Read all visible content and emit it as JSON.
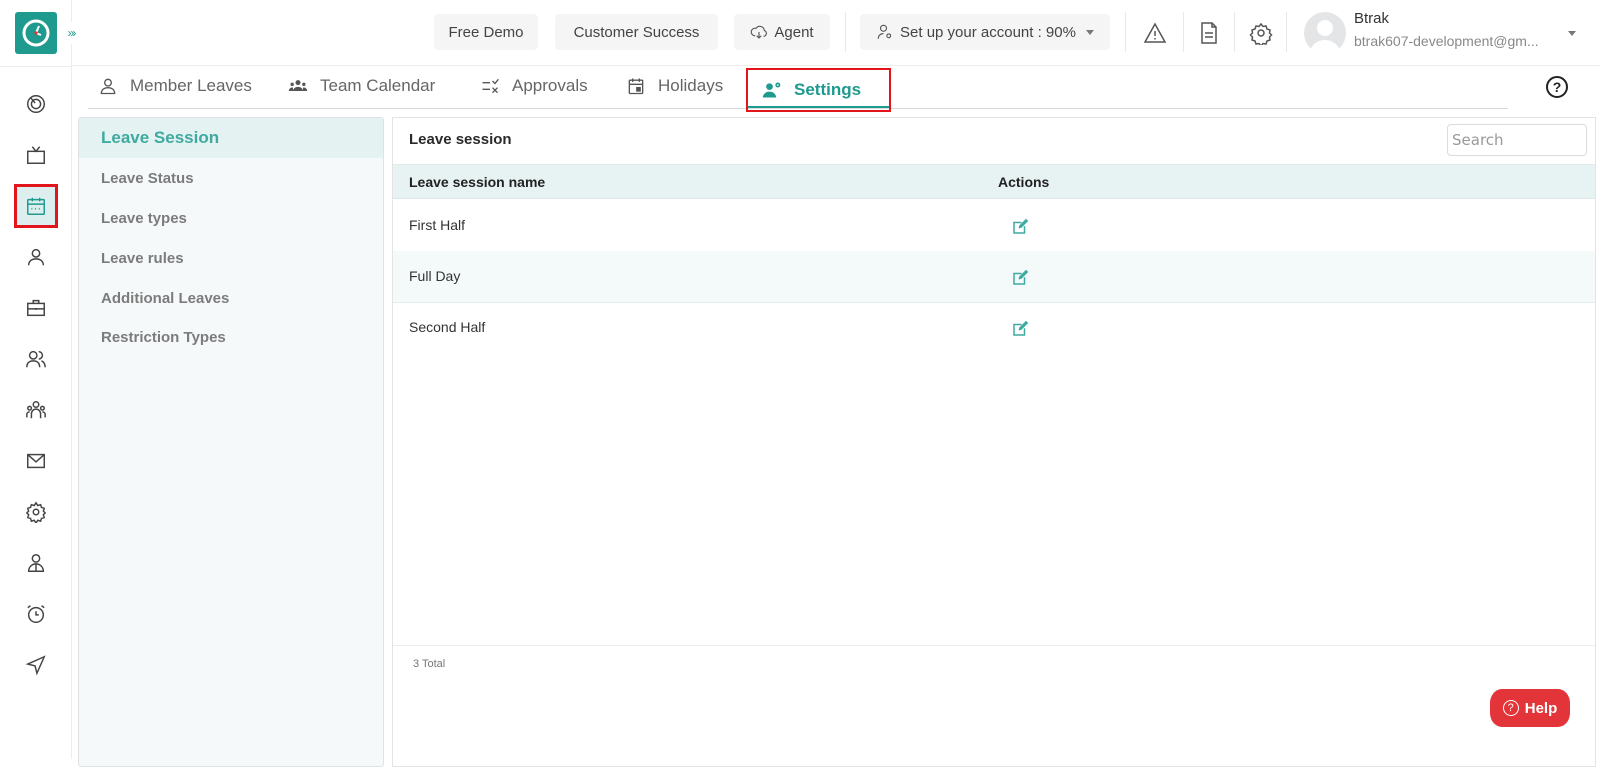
{
  "app": {
    "brand_color": "#1f9a8f",
    "highlight_color": "#e2141c",
    "expand_label": "»›"
  },
  "rail": {
    "items": [
      {
        "icon": "target-icon",
        "label": "Dashboard"
      },
      {
        "icon": "tv-icon",
        "label": "Display"
      },
      {
        "icon": "calendar-icon",
        "label": "Leave Management",
        "active": true
      },
      {
        "icon": "user-icon",
        "label": "Profile"
      },
      {
        "icon": "briefcase-icon",
        "label": "Assets"
      },
      {
        "icon": "users-icon",
        "label": "Employees"
      },
      {
        "icon": "team-icon",
        "label": "Teams"
      },
      {
        "icon": "mail-icon",
        "label": "Mail"
      },
      {
        "icon": "gear-icon",
        "label": "Settings"
      },
      {
        "icon": "person-badge-icon",
        "label": "Recruitment"
      },
      {
        "icon": "alarm-icon",
        "label": "Timesheet"
      },
      {
        "icon": "send-icon",
        "label": "Messages"
      }
    ]
  },
  "topbar": {
    "free_demo": "Free Demo",
    "customer_success": "Customer Success",
    "agent": "Agent",
    "setup_account": "Set up your account : 90%",
    "user": {
      "name": "Btrak",
      "email": "btrak607-development@gm..."
    }
  },
  "tabs": [
    {
      "label": "Member Leaves",
      "icon": "person-icon"
    },
    {
      "label": "Team Calendar",
      "icon": "group-icon"
    },
    {
      "label": "Approvals",
      "icon": "checklist-icon"
    },
    {
      "label": "Holidays",
      "icon": "calendar-day-icon"
    },
    {
      "label": "Settings",
      "icon": "user-settings-icon",
      "active": true
    }
  ],
  "submenu": {
    "items": [
      {
        "label": "Leave Session",
        "active": true
      },
      {
        "label": "Leave Status"
      },
      {
        "label": "Leave types"
      },
      {
        "label": "Leave rules"
      },
      {
        "label": "Additional Leaves"
      },
      {
        "label": "Restriction Types"
      }
    ]
  },
  "panel": {
    "title": "Leave session",
    "search_placeholder": "Search",
    "columns": [
      "Leave session name",
      "Actions"
    ],
    "rows": [
      {
        "name": "First Half"
      },
      {
        "name": "Full Day"
      },
      {
        "name": "Second Half"
      }
    ],
    "total": "3 Total"
  },
  "help_button": "Help"
}
